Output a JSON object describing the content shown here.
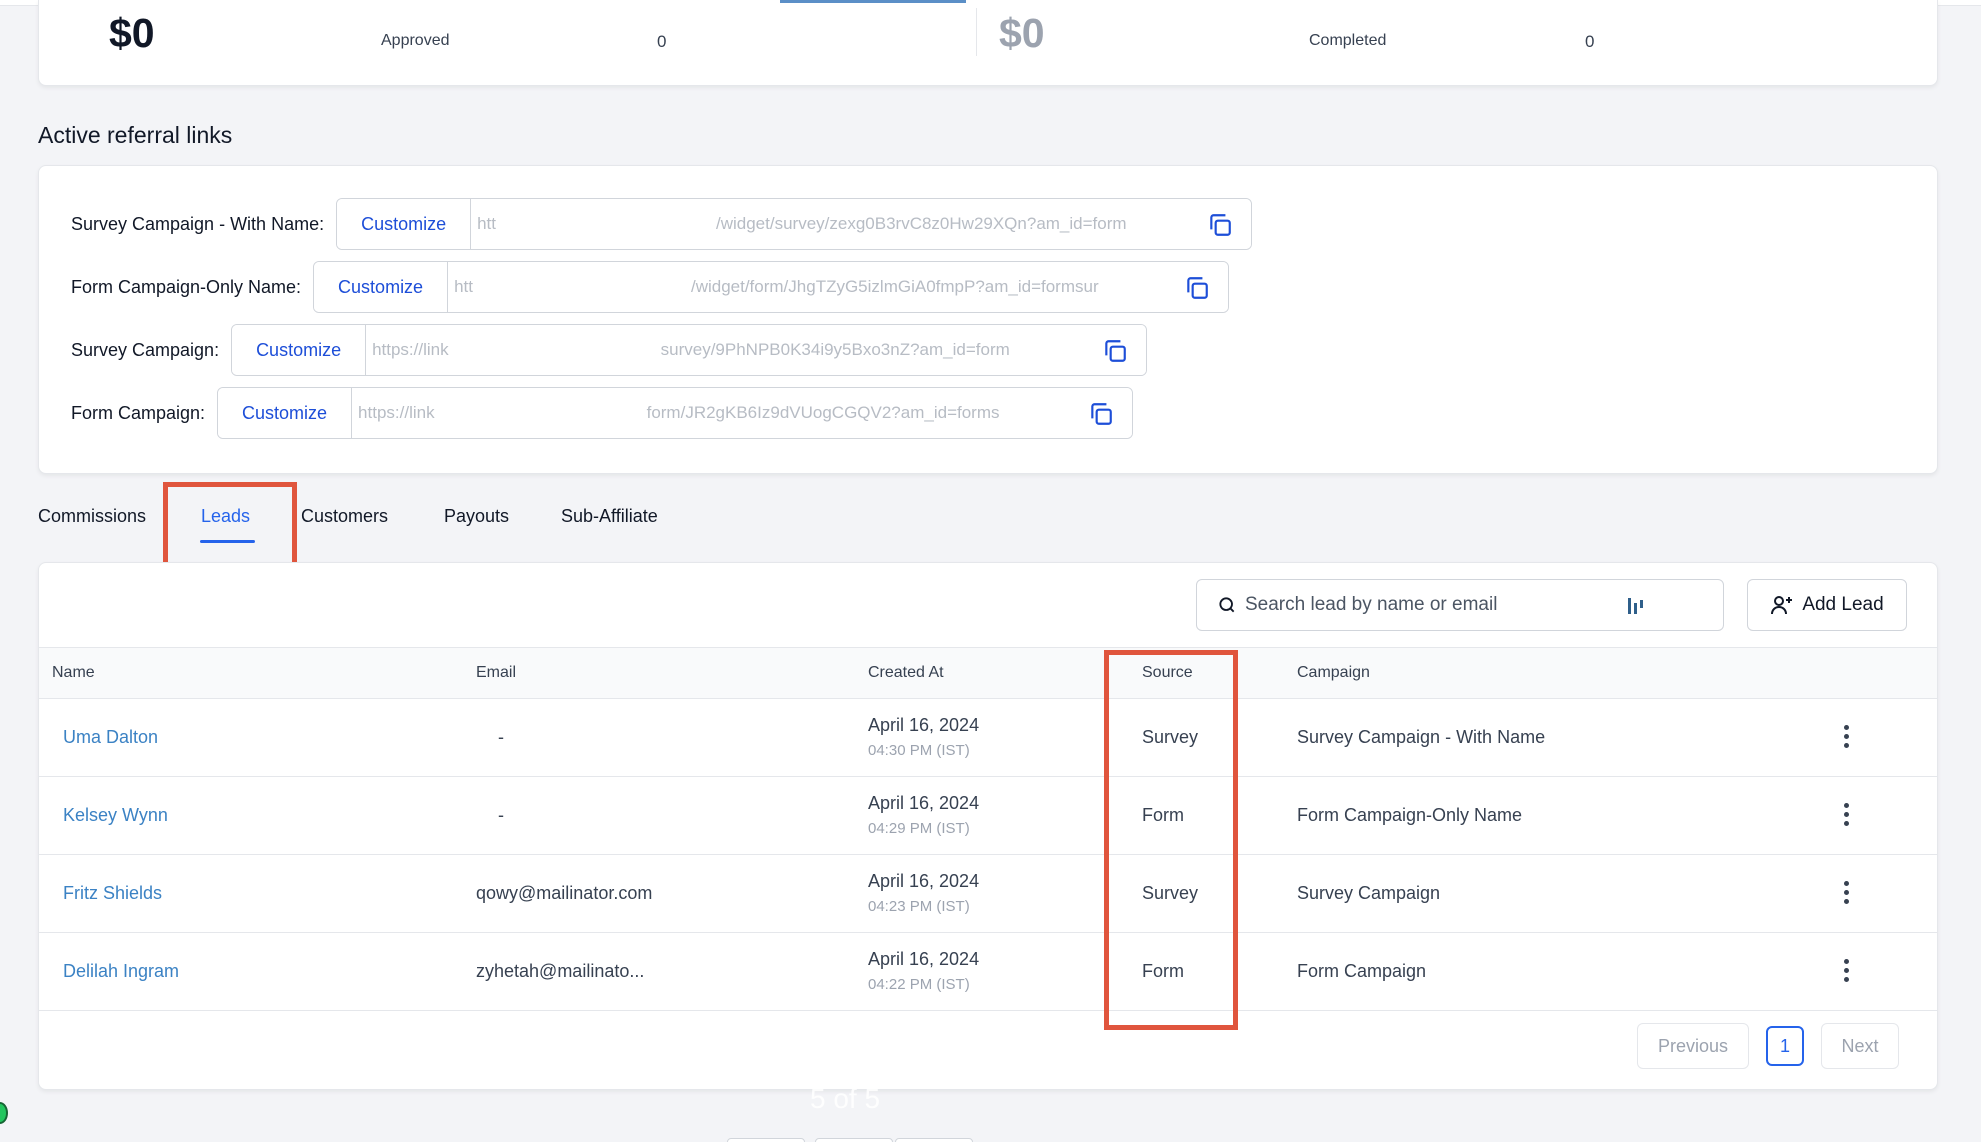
{
  "stats": {
    "left": {
      "amount": "$0",
      "label": "Approved",
      "count": "0"
    },
    "right": {
      "amount": "$0",
      "label": "Completed",
      "count": "0"
    }
  },
  "referral_section": {
    "title": "Active referral links",
    "customize_label": "Customize",
    "links": [
      {
        "label": "Survey Campaign - With Name:",
        "url_prefix": "htt",
        "url_suffix": "/widget/survey/zexg0B3rvC8z0Hw29XQn?am_id=form"
      },
      {
        "label": "Form Campaign-Only Name:",
        "url_prefix": "htt",
        "url_suffix": "/widget/form/JhgTZyG5izlmGiA0fmpP?am_id=formsur"
      },
      {
        "label": "Survey Campaign:",
        "url_prefix": "https://link",
        "url_suffix": "survey/9PhNPB0K34i9y5Bxo3nZ?am_id=form"
      },
      {
        "label": "Form Campaign:",
        "url_prefix": "https://link",
        "url_suffix": "form/JR2gKB6Iz9dVUogCGQV2?am_id=forms"
      }
    ]
  },
  "tabs": [
    {
      "label": "Commissions",
      "active": false
    },
    {
      "label": "Leads",
      "active": true
    },
    {
      "label": "Customers",
      "active": false
    },
    {
      "label": "Payouts",
      "active": false
    },
    {
      "label": "Sub-Affiliate",
      "active": false
    }
  ],
  "leads": {
    "search_placeholder": "Search lead by name or email",
    "add_lead_label": "Add Lead",
    "columns": [
      "Name",
      "Email",
      "Created At",
      "Source",
      "Campaign"
    ],
    "rows": [
      {
        "name": "Uma Dalton",
        "email": "-",
        "date": "April 16, 2024",
        "time": "04:30 PM (IST)",
        "source": "Survey",
        "campaign": "Survey Campaign - With Name"
      },
      {
        "name": "Kelsey Wynn",
        "email": "-",
        "date": "April 16, 2024",
        "time": "04:29 PM (IST)",
        "source": "Form",
        "campaign": "Form Campaign-Only Name"
      },
      {
        "name": "Fritz Shields",
        "email": "qowy@mailinator.com",
        "date": "April 16, 2024",
        "time": "04:23 PM (IST)",
        "source": "Survey",
        "campaign": "Survey Campaign"
      },
      {
        "name": "Delilah Ingram",
        "email": "zyhetah@mailinato...",
        "date": "April 16, 2024",
        "time": "04:22 PM (IST)",
        "source": "Form",
        "campaign": "Form Campaign"
      }
    ],
    "pagination": {
      "previous": "Previous",
      "current": "1",
      "next": "Next"
    }
  },
  "overlay": {
    "slide_counter": "5 of 5"
  },
  "colors": {
    "accent": "#2563eb",
    "link": "#3b82c4",
    "highlight": "#e0553d"
  }
}
